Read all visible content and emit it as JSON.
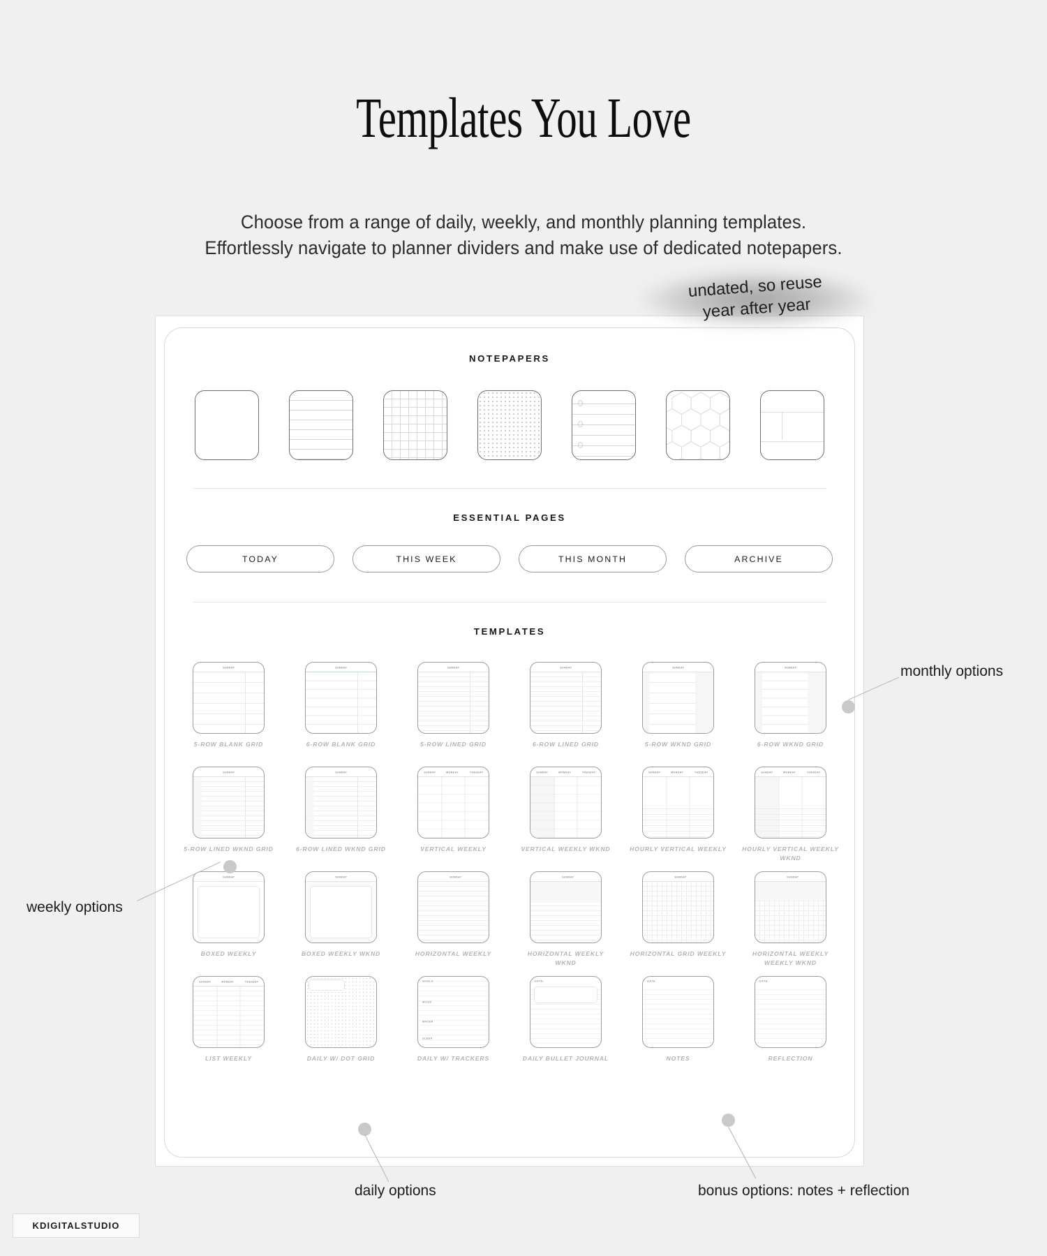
{
  "header": {
    "title": "Templates You Love",
    "subtitle_line1": "Choose from a range of daily, weekly, and monthly planning templates.",
    "subtitle_line2": "Effortlessly navigate to planner dividers and make use of dedicated notepapers."
  },
  "callout": {
    "line1": "undated, so reuse",
    "line2": "year after year"
  },
  "sections": {
    "notepapers_heading": "NOTEPAPERS",
    "essential_heading": "ESSENTIAL PAGES",
    "templates_heading": "TEMPLATES"
  },
  "notepapers": [
    {
      "name": "blank",
      "style": "blank"
    },
    {
      "name": "lined",
      "style": "lined"
    },
    {
      "name": "grid",
      "style": "grid"
    },
    {
      "name": "dotted",
      "style": "dots"
    },
    {
      "name": "checklist",
      "style": "checklist"
    },
    {
      "name": "hexagon",
      "style": "hex"
    },
    {
      "name": "cornell-split",
      "style": "split"
    }
  ],
  "essential_pages": [
    {
      "label": "TODAY"
    },
    {
      "label": "THIS WEEK"
    },
    {
      "label": "THIS MONTH"
    },
    {
      "label": "ARCHIVE"
    }
  ],
  "templates": [
    {
      "label": "5-ROW BLANK GRID",
      "day": "SUNDAY",
      "style": "rows5"
    },
    {
      "label": "6-ROW BLANK GRID",
      "day": "SUNDAY",
      "style": "rows6-accent"
    },
    {
      "label": "5-ROW LINED GRID",
      "day": "SUNDAY",
      "style": "lined5"
    },
    {
      "label": "6-ROW LINED GRID",
      "day": "SUNDAY",
      "style": "lined6"
    },
    {
      "label": "5-ROW WKND GRID",
      "day": "SUNDAY",
      "style": "wknd5"
    },
    {
      "label": "6-ROW WKND GRID",
      "day": "SUNDAY",
      "style": "wknd6"
    },
    {
      "label": "5-ROW LINED WKND GRID",
      "day": "SUNDAY",
      "style": "lined-wknd5"
    },
    {
      "label": "6-ROW LINED WKND GRID",
      "day": "SUNDAY",
      "style": "lined-wknd6"
    },
    {
      "label": "VERTICAL WEEKLY",
      "day": "SUNDAY  MONDAY  TUESDAY",
      "style": "vertical"
    },
    {
      "label": "VERTICAL WEEKLY WKND",
      "day": "SUNDAY  MONDAY  TUESDAY",
      "style": "vertical-wknd"
    },
    {
      "label": "HOURLY VERTICAL WEEKLY",
      "day": "SUNDAY  MONDAY  TUESDAY",
      "style": "hourly"
    },
    {
      "label": "HOURLY VERTICAL WEEKLY WKND",
      "day": "SUNDAY  MONDAY  TUESDAY",
      "style": "hourly-wknd"
    },
    {
      "label": "BOXED WEEKLY",
      "day": "",
      "style": "boxed"
    },
    {
      "label": "BOXED WEEKLY WKND",
      "day": "",
      "style": "boxed-wknd"
    },
    {
      "label": "HORIZONTAL WEEKLY",
      "day": "",
      "style": "horizontal"
    },
    {
      "label": "HORIZONTAL WEEKLY WKND",
      "day": "",
      "style": "horizontal-wknd"
    },
    {
      "label": "HORIZONTAL GRID WEEKLY",
      "day": "",
      "style": "hgrid"
    },
    {
      "label": "HORIZONTAL WEEKLY WEEKLY WKND",
      "day": "",
      "style": "hgrid-wknd"
    },
    {
      "label": "LIST WEEKLY",
      "day": "",
      "style": "list"
    },
    {
      "label": "DAILY W/ DOT GRID",
      "day": "",
      "style": "dotgrid"
    },
    {
      "label": "DAILY W/ TRACKERS",
      "day": "",
      "style": "trackers"
    },
    {
      "label": "DAILY BULLET JOURNAL",
      "day": "",
      "style": "bullet"
    },
    {
      "label": "NOTES",
      "day": "DATE:",
      "style": "notes"
    },
    {
      "label": "REFLECTION",
      "day": "DATE:",
      "style": "reflection"
    }
  ],
  "annotations": [
    {
      "text": "monthly options",
      "id": "monthly"
    },
    {
      "text": "weekly options",
      "id": "weekly"
    },
    {
      "text": "daily options",
      "id": "daily"
    },
    {
      "text": "bonus options: notes + reflection",
      "id": "bonus"
    }
  ],
  "footer": {
    "logo": "KDIGITALSTUDIO"
  },
  "colors": {
    "background": "#f0f0f0",
    "card": "#ffffff",
    "text": "#1a1a1a",
    "muted": "#b2b2b2",
    "line": "#dcdcdc"
  }
}
